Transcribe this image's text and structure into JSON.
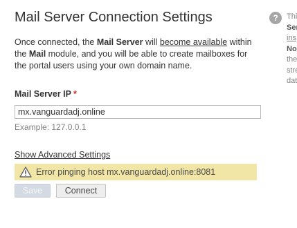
{
  "page": {
    "title": "Mail Server Connection Settings"
  },
  "description": {
    "part1": "Once connected, the ",
    "bold1": "Mail Server",
    "part2": " will ",
    "link": "become available",
    "part3": " within the ",
    "bold2": "Mail",
    "part4": " module, and you will be able to create mailboxes for the portal users using your own domain name."
  },
  "form": {
    "ip_label": "Mail Server IP",
    "required_mark": "*",
    "ip_value": "mx.vanguardadj.online",
    "example": "Example: 127.0.0.1"
  },
  "advanced": {
    "label": "Show Advanced Settings"
  },
  "error": {
    "icon": "warning-icon",
    "message": "Error pinging host mx.vanguardadj.online:8081",
    "color": "#f1e6a6"
  },
  "buttons": {
    "save": "Save",
    "connect": "Connect"
  },
  "help": {
    "icon": "question-icon",
    "glyph": "?",
    "lines": [
      "Thi",
      "Ser",
      "ins",
      "No",
      "the",
      "stre",
      "dat"
    ]
  }
}
